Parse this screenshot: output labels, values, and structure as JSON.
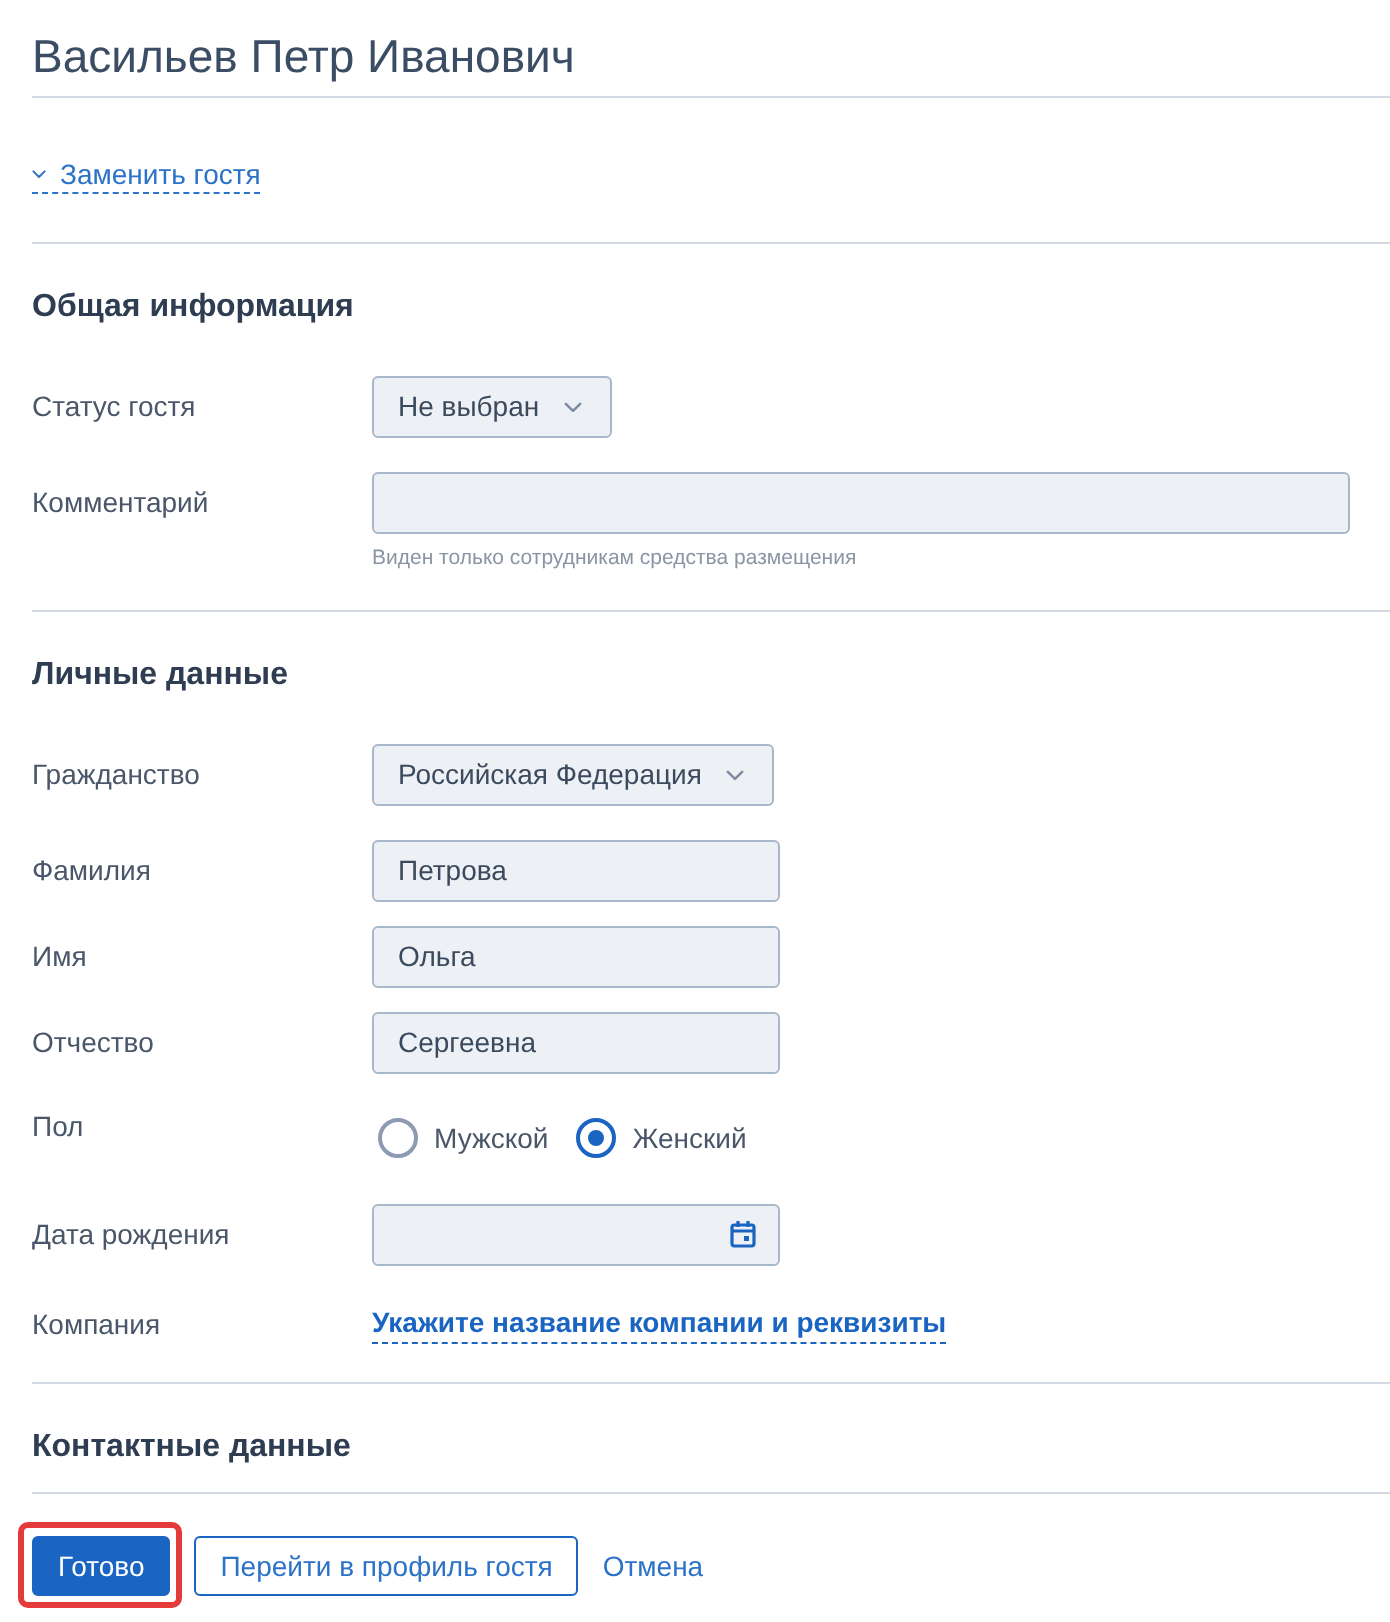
{
  "title": "Васильев Петр Иванович",
  "replace_link": {
    "label": "Заменить гостя"
  },
  "sections": [
    {
      "heading": "Общая информация",
      "fields": [
        {
          "kind": "select",
          "label": "Статус гостя",
          "value": "Не выбран"
        },
        {
          "kind": "note",
          "label": "Комментарий",
          "hint": "Виден только сотрудникам средства размещения"
        }
      ]
    },
    {
      "heading": "Личные данные",
      "fields": [
        {
          "kind": "select",
          "label": "Гражданство",
          "value": "Российская Федерация"
        },
        {
          "kind": "text",
          "label": "Фамилия",
          "value": "Петрова"
        },
        {
          "kind": "text",
          "label": "Имя",
          "value": "Ольга"
        },
        {
          "kind": "text",
          "label": "Отчество",
          "value": "Сергеевна"
        },
        {
          "kind": "radio",
          "label": "Пол",
          "options": [
            {
              "label": "Мужской",
              "selected": false
            },
            {
              "label": "Женский",
              "selected": true
            }
          ]
        },
        {
          "kind": "date",
          "label": "Дата рождения"
        },
        {
          "kind": "link",
          "label": "Компания",
          "value": "Укажите название компании и реквизиты"
        }
      ]
    },
    {
      "heading": "Контактные данные"
    }
  ],
  "actions": [
    {
      "kind": "primary",
      "label": "Готово",
      "highlighted": true
    },
    {
      "kind": "secondary",
      "label": "Перейти в профиль гостя",
      "highlighted": false
    },
    {
      "kind": "link",
      "label": "Отмена",
      "highlighted": false
    }
  ]
}
